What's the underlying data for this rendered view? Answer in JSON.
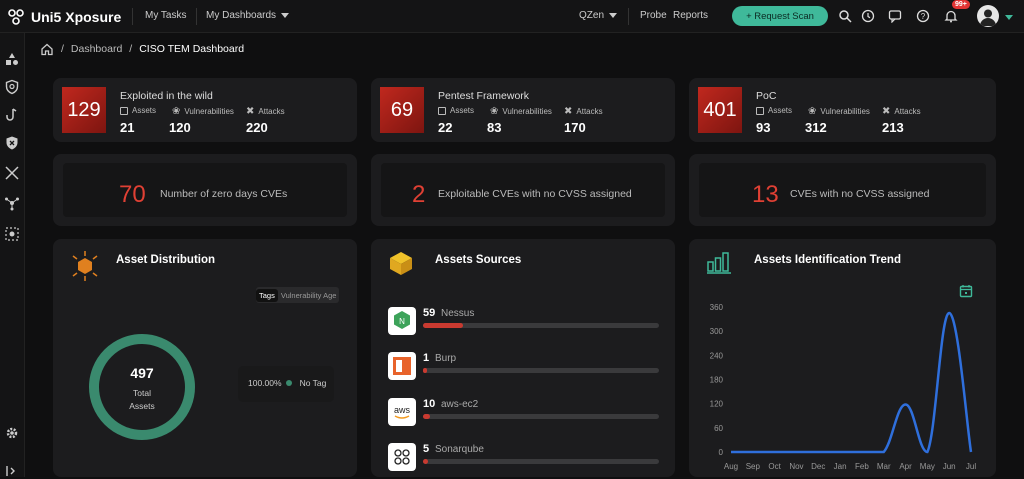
{
  "app": {
    "title": "Uni5 Xposure"
  },
  "nav": {
    "my_tasks": "My Tasks",
    "my_dashboards": "My Dashboards",
    "org": "QZen",
    "probe": "Probe",
    "reports": "Reports",
    "request_scan": "+ Request Scan",
    "notif_badge": "99+"
  },
  "breadcrumb": {
    "root": "Dashboard",
    "current": "CISO TEM Dashboard"
  },
  "kpis": [
    {
      "value": "129",
      "title": "Exploited in the wild",
      "assets_label": "Assets",
      "vulns_label": "Vulnerabilities",
      "attacks_label": "Attacks",
      "assets": "21",
      "vulns": "120",
      "attacks": "220"
    },
    {
      "value": "69",
      "title": "Pentest Framework",
      "assets_label": "Assets",
      "vulns_label": "Vulnerabilities",
      "attacks_label": "Attacks",
      "assets": "22",
      "vulns": "83",
      "attacks": "170"
    },
    {
      "value": "401",
      "title": "PoC",
      "assets_label": "Assets",
      "vulns_label": "Vulnerabilities",
      "attacks_label": "Attacks",
      "assets": "93",
      "vulns": "312",
      "attacks": "213"
    }
  ],
  "cve_stats": [
    {
      "value": "70",
      "label": "Number of zero days CVEs"
    },
    {
      "value": "2",
      "label": "Exploitable CVEs with no CVSS assigned"
    },
    {
      "value": "13",
      "label": "CVEs with no CVSS assigned"
    }
  ],
  "asset_distribution": {
    "title": "Asset Distribution",
    "tabs": [
      "Tags",
      "Vulnerability Age"
    ],
    "active_tab": "Tags",
    "total": "497",
    "total_label": "Total Assets",
    "legend_pct": "100.00%",
    "legend_label": "No Tag",
    "color": "#3a8a6e"
  },
  "asset_sources": {
    "title": "Assets Sources",
    "items": [
      {
        "count": "59",
        "name": "Nessus",
        "fraction": 0.17
      },
      {
        "count": "1",
        "name": "Burp",
        "fraction": 0.015
      },
      {
        "count": "10",
        "name": "aws-ec2",
        "fraction": 0.03
      },
      {
        "count": "5",
        "name": "Sonarqube",
        "fraction": 0.02
      }
    ]
  },
  "chart_data": {
    "type": "line",
    "title": "Assets Identification Trend",
    "categories": [
      "Aug",
      "Sep",
      "Oct",
      "Nov",
      "Dec",
      "Jan",
      "Feb",
      "Mar",
      "Apr",
      "May",
      "Jun",
      "Jul"
    ],
    "series": [
      {
        "values": [
          0,
          0,
          0,
          0,
          0,
          0,
          0,
          0,
          118,
          0,
          345,
          0
        ]
      }
    ],
    "y_ticks": [
      "0",
      "60",
      "120",
      "180",
      "240",
      "300",
      "360"
    ],
    "ylim": [
      0,
      360
    ],
    "color": "#2f6fdc"
  }
}
